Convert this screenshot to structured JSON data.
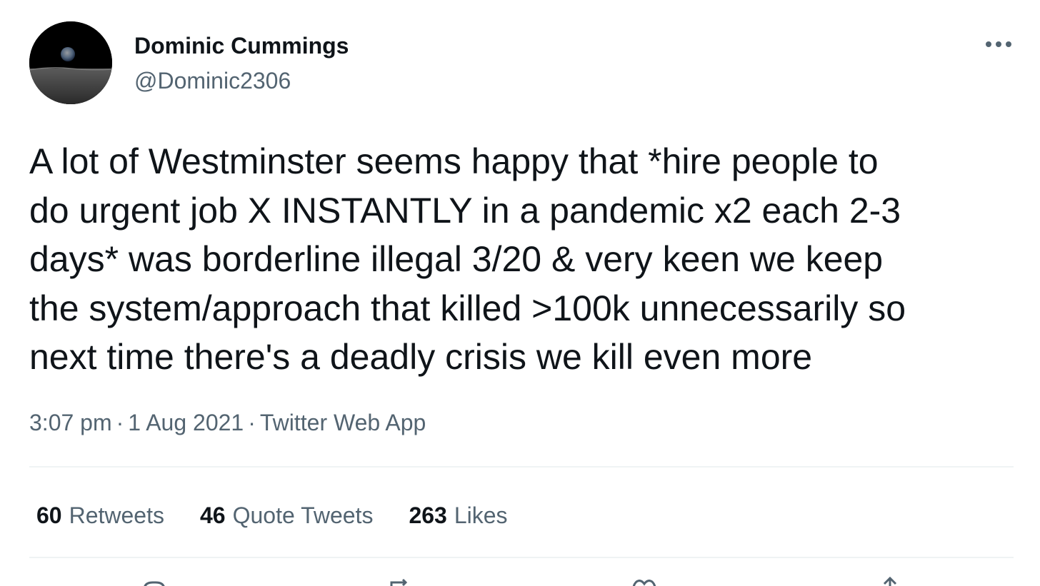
{
  "author": {
    "name": "Dominic Cummings",
    "handle": "@Dominic2306",
    "avatar_icon": "earthrise-avatar"
  },
  "more_icon": "more-dots-icon",
  "tweet": {
    "text": "A lot of Westminster seems happy that *hire people to\ndo urgent job X INSTANTLY in a pandemic x2 each 2-3\ndays* was borderline illegal 3/20 & very keen we keep\nthe system/approach that killed >100k unnecessarily so\nnext time there's a deadly crisis we kill even more"
  },
  "meta": {
    "time": "3:07 pm",
    "separator": "·",
    "date": "1 Aug 2021",
    "source": "Twitter Web App"
  },
  "stats": {
    "retweets": {
      "count": "60",
      "label": "Retweets"
    },
    "quotes": {
      "count": "46",
      "label": "Quote Tweets"
    },
    "likes": {
      "count": "263",
      "label": "Likes"
    }
  },
  "actions": [
    "reply-icon",
    "retweet-icon",
    "like-icon",
    "share-icon"
  ],
  "colors": {
    "text_primary": "#0f1419",
    "text_secondary": "#536471",
    "divider": "#eff3f4"
  }
}
